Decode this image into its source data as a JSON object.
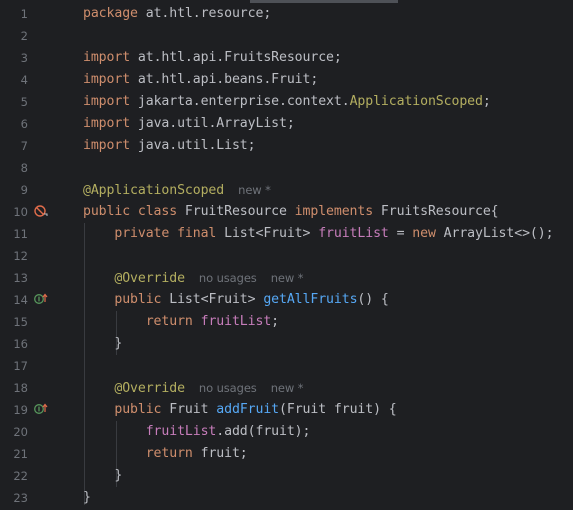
{
  "colors": {
    "background": "#1e1f22",
    "line_number": "#6f737a",
    "plain": "#bcbec4",
    "keyword": "#cf8e6d",
    "annotation": "#b3ae60",
    "field": "#c77dbb",
    "method": "#56a8f5",
    "hint": "#6f737a"
  },
  "gutter_icons": {
    "line_10": "no-entry-implements-icon",
    "line_14": "implements-method-up-arrow-icon",
    "line_19": "implements-method-up-arrow-icon"
  },
  "lines": [
    {
      "num": "1",
      "tokens": [
        {
          "t": "package",
          "c": "kw"
        },
        {
          "t": " at.htl.resource;",
          "c": "plain"
        }
      ]
    },
    {
      "num": "2",
      "tokens": []
    },
    {
      "num": "3",
      "tokens": [
        {
          "t": "import",
          "c": "kw"
        },
        {
          "t": " at.htl.api.FruitsResource;",
          "c": "plain"
        }
      ]
    },
    {
      "num": "4",
      "tokens": [
        {
          "t": "import",
          "c": "kw"
        },
        {
          "t": " at.htl.api.beans.Fruit;",
          "c": "plain"
        }
      ]
    },
    {
      "num": "5",
      "tokens": [
        {
          "t": "import",
          "c": "kw"
        },
        {
          "t": " jakarta.enterprise.context.",
          "c": "plain"
        },
        {
          "t": "ApplicationScoped",
          "c": "ann"
        },
        {
          "t": ";",
          "c": "plain"
        }
      ]
    },
    {
      "num": "6",
      "tokens": [
        {
          "t": "import",
          "c": "kw"
        },
        {
          "t": " java.util.ArrayList;",
          "c": "plain"
        }
      ]
    },
    {
      "num": "7",
      "tokens": [
        {
          "t": "import",
          "c": "kw"
        },
        {
          "t": " java.util.List;",
          "c": "plain"
        }
      ]
    },
    {
      "num": "8",
      "tokens": []
    },
    {
      "num": "9",
      "tokens": [
        {
          "t": "@ApplicationScoped",
          "c": "ann"
        }
      ],
      "hints": [
        "new *"
      ]
    },
    {
      "num": "10",
      "tokens": [
        {
          "t": "public class",
          "c": "kw"
        },
        {
          "t": " FruitResource ",
          "c": "plain"
        },
        {
          "t": "implements",
          "c": "kw"
        },
        {
          "t": " FruitsResource{",
          "c": "plain"
        }
      ]
    },
    {
      "num": "11",
      "tokens": [
        {
          "t": "    ",
          "c": "plain"
        },
        {
          "t": "private final",
          "c": "kw"
        },
        {
          "t": " List<Fruit> ",
          "c": "plain"
        },
        {
          "t": "fruitList",
          "c": "fld"
        },
        {
          "t": " = ",
          "c": "plain"
        },
        {
          "t": "new",
          "c": "kw"
        },
        {
          "t": " ArrayList<>();",
          "c": "plain"
        }
      ]
    },
    {
      "num": "12",
      "tokens": []
    },
    {
      "num": "13",
      "tokens": [
        {
          "t": "    ",
          "c": "plain"
        },
        {
          "t": "@Override",
          "c": "ann"
        }
      ],
      "hints": [
        "no usages",
        "new *"
      ]
    },
    {
      "num": "14",
      "tokens": [
        {
          "t": "    ",
          "c": "plain"
        },
        {
          "t": "public",
          "c": "kw"
        },
        {
          "t": " List<Fruit> ",
          "c": "plain"
        },
        {
          "t": "getAllFruits",
          "c": "fn"
        },
        {
          "t": "() {",
          "c": "plain"
        }
      ]
    },
    {
      "num": "15",
      "tokens": [
        {
          "t": "        ",
          "c": "plain"
        },
        {
          "t": "return",
          "c": "kw"
        },
        {
          "t": " ",
          "c": "plain"
        },
        {
          "t": "fruitList",
          "c": "fld"
        },
        {
          "t": ";",
          "c": "plain"
        }
      ]
    },
    {
      "num": "16",
      "tokens": [
        {
          "t": "    }",
          "c": "plain"
        }
      ]
    },
    {
      "num": "17",
      "tokens": []
    },
    {
      "num": "18",
      "tokens": [
        {
          "t": "    ",
          "c": "plain"
        },
        {
          "t": "@Override",
          "c": "ann"
        }
      ],
      "hints": [
        "no usages",
        "new *"
      ]
    },
    {
      "num": "19",
      "tokens": [
        {
          "t": "    ",
          "c": "plain"
        },
        {
          "t": "public",
          "c": "kw"
        },
        {
          "t": " Fruit ",
          "c": "plain"
        },
        {
          "t": "addFruit",
          "c": "fn"
        },
        {
          "t": "(Fruit fruit) {",
          "c": "plain"
        }
      ]
    },
    {
      "num": "20",
      "tokens": [
        {
          "t": "        ",
          "c": "plain"
        },
        {
          "t": "fruitList",
          "c": "fld"
        },
        {
          "t": ".add(fruit);",
          "c": "plain"
        }
      ]
    },
    {
      "num": "21",
      "tokens": [
        {
          "t": "        ",
          "c": "plain"
        },
        {
          "t": "return",
          "c": "kw"
        },
        {
          "t": " fruit;",
          "c": "plain"
        }
      ]
    },
    {
      "num": "22",
      "tokens": [
        {
          "t": "    }",
          "c": "plain"
        }
      ]
    },
    {
      "num": "23",
      "tokens": [
        {
          "t": "}",
          "c": "plain"
        }
      ]
    }
  ]
}
